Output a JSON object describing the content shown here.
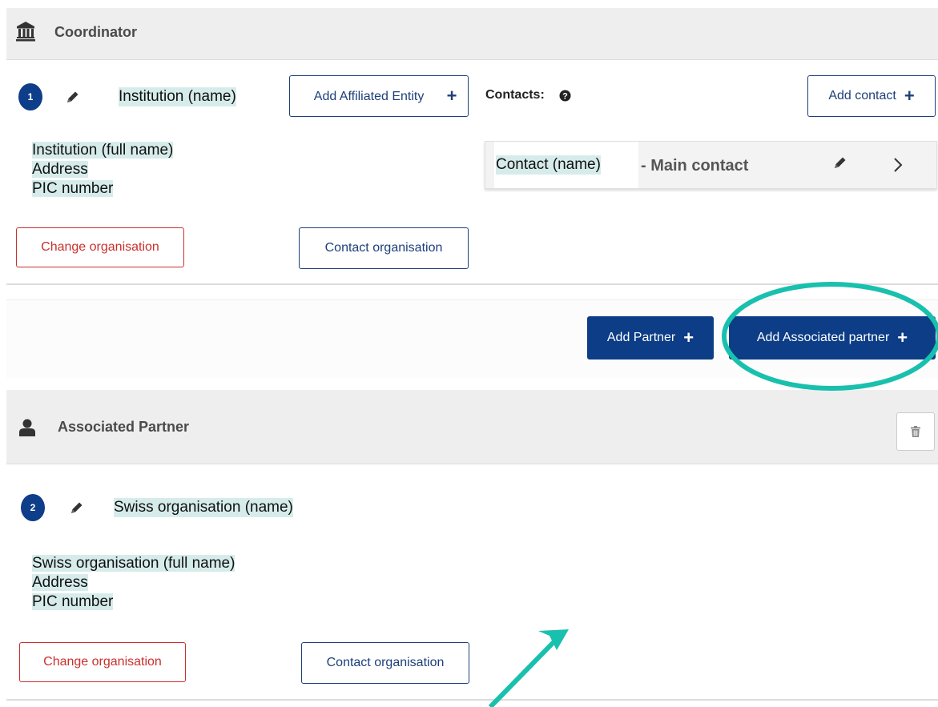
{
  "coordinator": {
    "title": "Coordinator",
    "badge": "1",
    "name": "Institution (name)",
    "add_affiliated_label": "Add Affiliated Entity",
    "contacts_label": "Contacts:",
    "add_contact_label": "Add contact",
    "details": {
      "full_name": "Institution (full name)",
      "address": "Address",
      "pic": "PIC number"
    },
    "contact": {
      "name": "Contact (name)",
      "role": "- Main contact"
    },
    "change_org_label": "Change organisation",
    "contact_org_label": "Contact organisation"
  },
  "actions": {
    "add_partner_label": "Add Partner",
    "add_associated_label": "Add Associated partner"
  },
  "associated": {
    "title": "Associated Partner",
    "badge": "2",
    "name": "Swiss organisation (name)",
    "details": {
      "full_name": "Swiss organisation (full name)",
      "address": "Address",
      "pic": "PIC number"
    },
    "change_org_label": "Change organisation",
    "contact_org_label": "Contact organisation"
  },
  "colors": {
    "primary": "#0c3d86",
    "danger": "#c9302c",
    "highlight": "#d6ecea",
    "annotation": "#19c0ad"
  }
}
